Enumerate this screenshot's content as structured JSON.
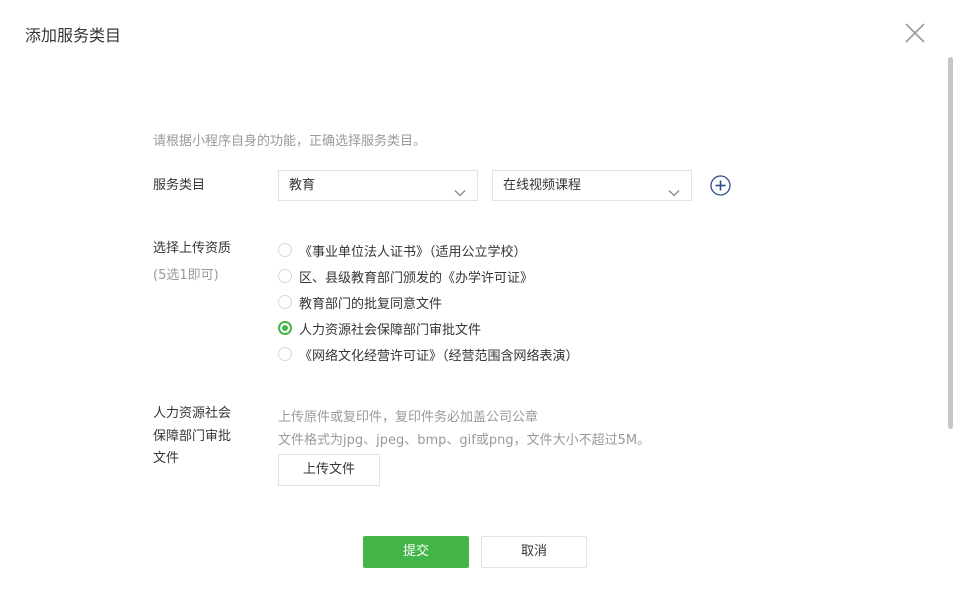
{
  "dialog": {
    "title": "添加服务类目",
    "close_icon": "close-icon"
  },
  "hint": "请根据小程序自身的功能，正确选择服务类目。",
  "category": {
    "label": "服务类目",
    "primary_value": "教育",
    "secondary_value": "在线视频课程",
    "add_icon": "plus-circle-icon"
  },
  "qualification": {
    "label": "选择上传资质",
    "sublabel": "(5选1即可)",
    "options": [
      {
        "label": "《事业单位法人证书》（适用公立学校）",
        "checked": false
      },
      {
        "label": "区、县级教育部门颁发的《办学许可证》",
        "checked": false
      },
      {
        "label": "教育部门的批复同意文件",
        "checked": false
      },
      {
        "label": "人力资源社会保障部门审批文件",
        "checked": true
      },
      {
        "label": "《网络文化经营许可证》（经营范围含网络表演）",
        "checked": false
      }
    ]
  },
  "upload": {
    "label_line1": "人力资源社会",
    "label_line2": "保障部门审批",
    "label_line3": "文件",
    "tip1": "上传原件或复印件，复印件务必加盖公司公章",
    "tip2": "文件格式为jpg、jpeg、bmp、gif或png，文件大小不超过5M。",
    "button_label": "上传文件"
  },
  "actions": {
    "submit_label": "提交",
    "cancel_label": "取消"
  },
  "colors": {
    "accent": "#44b549",
    "border": "#e2e2e2",
    "muted_text": "#9a9a9a",
    "text": "#353535"
  }
}
